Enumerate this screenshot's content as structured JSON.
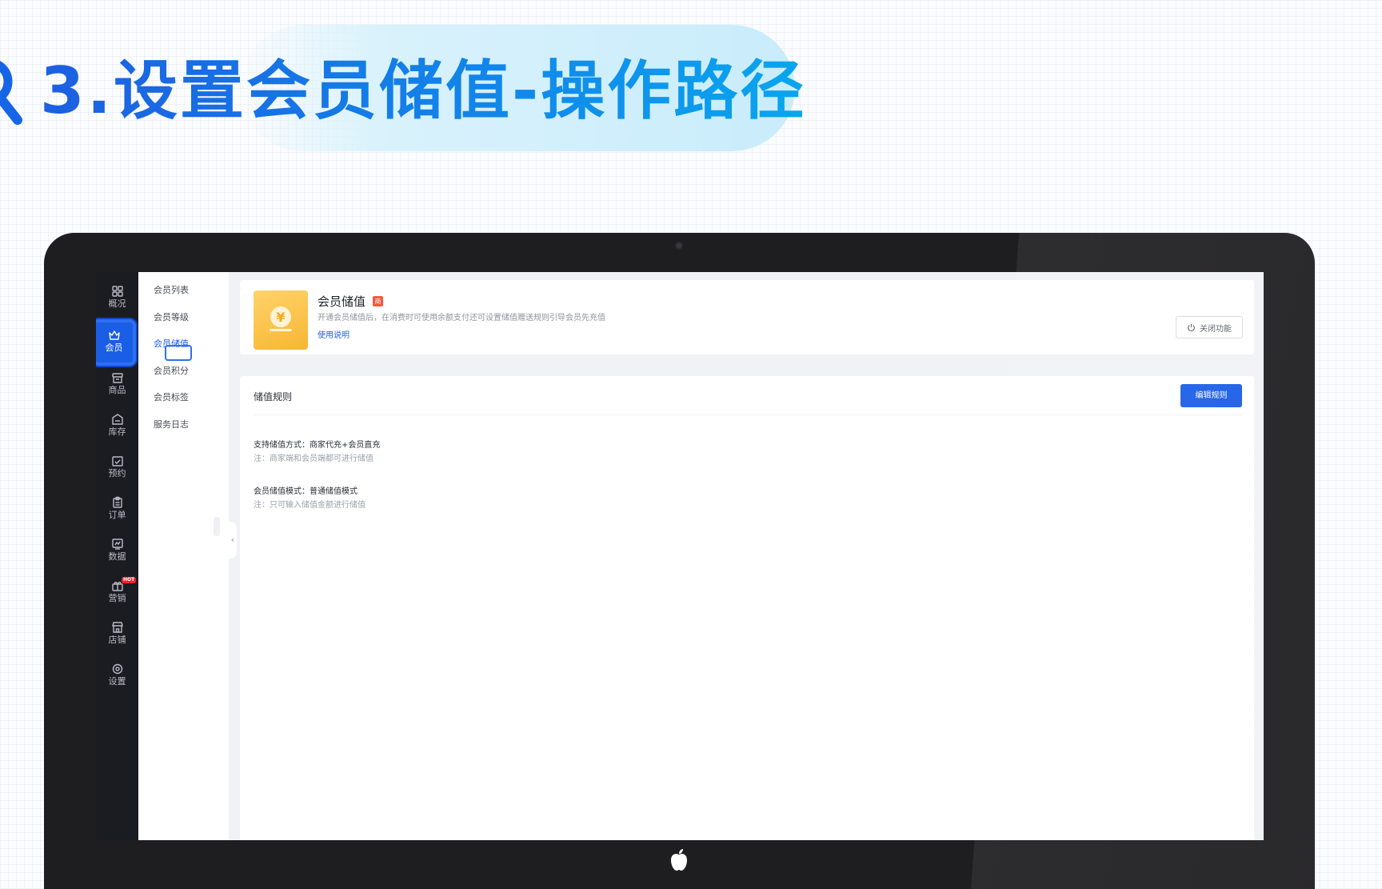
{
  "heading": {
    "title": "3.设置会员储值-操作路径"
  },
  "sidenav": {
    "items": [
      {
        "label": "概况",
        "icon": "grid-icon"
      },
      {
        "label": "会员",
        "icon": "crown-icon",
        "active": true
      },
      {
        "label": "商品",
        "icon": "shop-box-icon"
      },
      {
        "label": "库存",
        "icon": "inventory-icon"
      },
      {
        "label": "预约",
        "icon": "calendar-check-icon"
      },
      {
        "label": "订单",
        "icon": "clipboard-icon"
      },
      {
        "label": "数据",
        "icon": "chart-icon"
      },
      {
        "label": "营销",
        "icon": "gift-icon",
        "badge": "HOT"
      },
      {
        "label": "店铺",
        "icon": "store-icon"
      },
      {
        "label": "设置",
        "icon": "settings-icon"
      }
    ]
  },
  "subnav": {
    "items": [
      {
        "label": "会员列表"
      },
      {
        "label": "会员等级"
      },
      {
        "label": "会员储值",
        "active": true
      },
      {
        "label": "会员积分"
      },
      {
        "label": "会员标签"
      },
      {
        "label": "服务日志"
      }
    ]
  },
  "feature": {
    "title": "会员储值",
    "tag": "商",
    "description": "开通会员储值后，在消费时可使用余额支付还可设置储值赠送规则引导会员先充值",
    "usage_link": "使用说明",
    "close_button": "关闭功能",
    "icon_symbol": "¥"
  },
  "rules": {
    "section_title": "储值规则",
    "edit_button": "编辑规则",
    "method_label": "支持储值方式：",
    "method_value": "商家代充+会员直充",
    "method_note": "注：商家端和会员端都可进行储值",
    "mode_label": "会员储值模式：",
    "mode_value": "普通储值模式",
    "mode_note": "注：只可输入储值金额进行储值"
  },
  "colors": {
    "primary": "#1a5ee6",
    "heading_gradient_start": "#1d5fe0",
    "heading_gradient_end": "#0aa6ee",
    "sidenav_bg": "#1b1c21",
    "feature_icon": "#f7b632",
    "tag_red": "#f15a3d"
  }
}
